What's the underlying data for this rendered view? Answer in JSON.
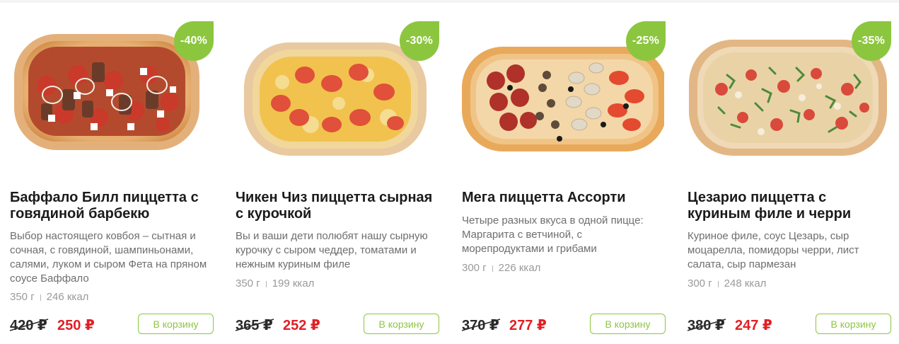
{
  "colors": {
    "accent_green": "#8cc63f",
    "price_red": "#e31e24",
    "title_dark": "#1b1b1b",
    "description_gray": "#6e6e6e",
    "meta_gray": "#9a9a9a"
  },
  "products": [
    {
      "badge": "-40%",
      "title": "Баффало Билл пиццетта с говядиной барбекю",
      "description": "Выбор настоящего ковбоя – сытная и сочная, с говядиной, шампиньонами, салями, луком и сыром Фета на пряном соусе Баффало",
      "weight": "350 г",
      "calories": "246 ккал",
      "old_price": "420 ₽",
      "new_price": "250 ₽",
      "button_label": "В корзину",
      "image_icon": "pizza-image"
    },
    {
      "badge": "-30%",
      "title": "Чикен Чиз пиццетта сырная с курочкой",
      "description": "Вы и ваши дети полюбят нашу сырную курочку с сыром чеддер, томатами и нежным куриным филе",
      "weight": "350 г",
      "calories": "199 ккал",
      "old_price": "365 ₽",
      "new_price": "252 ₽",
      "button_label": "В корзину",
      "image_icon": "pizza-image"
    },
    {
      "badge": "-25%",
      "title": "Мега пиццетта Ассорти",
      "description": "Четыре разных вкуса в одной пицце: Маргарита с ветчиной, с морепродуктами и грибами",
      "weight": "300 г",
      "calories": "226 ккал",
      "old_price": "370 ₽",
      "new_price": "277 ₽",
      "button_label": "В корзину",
      "image_icon": "pizza-image"
    },
    {
      "badge": "-35%",
      "title": "Цезарио пиццетта с куриным филе и черри",
      "description": "Куриное филе, соус Цезарь, сыр моцарелла, помидоры черри, лист салата, сыр пармезан",
      "weight": "300 г",
      "calories": "248 ккал",
      "old_price": "380 ₽",
      "new_price": "247 ₽",
      "button_label": "В корзину",
      "image_icon": "pizza-image"
    }
  ]
}
